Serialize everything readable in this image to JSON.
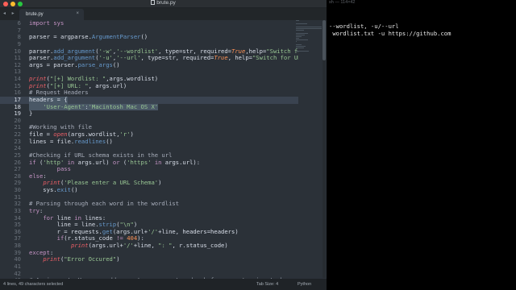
{
  "window": {
    "title": "brute.py"
  },
  "tab": {
    "label": "brute.py",
    "close": "×",
    "nav_arrows": "◂ ▸"
  },
  "colors": {
    "editor_bg": "#2b3138",
    "keyword": "#c594c5",
    "function": "#6699cc",
    "string": "#99c794",
    "comment": "#a7adba",
    "constant": "#f99157",
    "builtin": "#ec5f67"
  },
  "code_lines": [
    {
      "n": "6",
      "segments": [
        [
          "import sys",
          "kw"
        ]
      ]
    },
    {
      "n": "7",
      "segments": [
        [
          "",
          ""
        ]
      ]
    },
    {
      "n": "8",
      "segments": [
        [
          "parser = argparse.",
          ""
        ],
        [
          "ArgumentParser",
          "fn"
        ],
        [
          "()",
          ""
        ]
      ]
    },
    {
      "n": "9",
      "segments": [
        [
          "",
          ""
        ]
      ]
    },
    {
      "n": "10",
      "segments": [
        [
          "parser.",
          ""
        ],
        [
          "add_argument",
          "fn"
        ],
        [
          "(",
          ""
        ],
        [
          "'-w'",
          "st"
        ],
        [
          ",",
          ""
        ],
        [
          "'--wordlist'",
          "st"
        ],
        [
          ", type=str, required=",
          ""
        ],
        [
          "True",
          "ct"
        ],
        [
          ",help=",
          ""
        ],
        [
          "\"Switch for W",
          "st"
        ]
      ]
    },
    {
      "n": "11",
      "segments": [
        [
          "parser.",
          ""
        ],
        [
          "add_argument",
          "fn"
        ],
        [
          "(",
          ""
        ],
        [
          "'-u'",
          "st"
        ],
        [
          ",",
          ""
        ],
        [
          "'--url'",
          "st"
        ],
        [
          ", type=str, required=",
          ""
        ],
        [
          "True",
          "ct"
        ],
        [
          ", help=",
          ""
        ],
        [
          "\"Switch for URL\"",
          "st"
        ],
        [
          ")",
          ""
        ]
      ]
    },
    {
      "n": "12",
      "segments": [
        [
          "args = parser.",
          ""
        ],
        [
          "parse_args",
          "fn"
        ],
        [
          "()",
          ""
        ]
      ]
    },
    {
      "n": "13",
      "segments": [
        [
          "",
          ""
        ]
      ]
    },
    {
      "n": "14",
      "segments": [
        [
          "print",
          "bi"
        ],
        [
          "(",
          ""
        ],
        [
          "\"[+] Wordlist: \"",
          "st"
        ],
        [
          ",args.wordlist)",
          ""
        ]
      ]
    },
    {
      "n": "15",
      "segments": [
        [
          "print",
          "bi"
        ],
        [
          "(",
          ""
        ],
        [
          "\"[+] URL: \"",
          "st"
        ],
        [
          ", args.url)",
          ""
        ]
      ]
    },
    {
      "n": "16",
      "segments": [
        [
          "# Request Headers",
          "cm"
        ]
      ]
    },
    {
      "n": "17",
      "segments": [
        [
          "headers = {",
          ""
        ]
      ],
      "sel": true
    },
    {
      "n": "18",
      "segments": [
        [
          "    ",
          ""
        ],
        [
          "'User-Agent'",
          "st"
        ],
        [
          ":",
          ""
        ],
        [
          "'Macintosh Mac OS X'",
          "st"
        ]
      ],
      "sel": true
    },
    {
      "n": "19",
      "segments": [
        [
          "}",
          ""
        ]
      ],
      "sel": true
    },
    {
      "n": "20",
      "segments": [
        [
          "",
          ""
        ]
      ]
    },
    {
      "n": "21",
      "segments": [
        [
          "#Working with file",
          "cm"
        ]
      ]
    },
    {
      "n": "22",
      "segments": [
        [
          "file = ",
          ""
        ],
        [
          "open",
          "bi"
        ],
        [
          "(args.wordlist,",
          ""
        ],
        [
          "'r'",
          "st"
        ],
        [
          ")",
          ""
        ]
      ]
    },
    {
      "n": "23",
      "segments": [
        [
          "lines = file.",
          ""
        ],
        [
          "readlines",
          "fn"
        ],
        [
          "()",
          ""
        ]
      ]
    },
    {
      "n": "24",
      "segments": [
        [
          "",
          ""
        ]
      ]
    },
    {
      "n": "25",
      "segments": [
        [
          "#Checking if URL schema exists in the url",
          "cm"
        ]
      ]
    },
    {
      "n": "26",
      "segments": [
        [
          "if",
          "kw"
        ],
        [
          " (",
          ""
        ],
        [
          "'http'",
          "st"
        ],
        [
          " ",
          ""
        ],
        [
          "in",
          "kw"
        ],
        [
          " args.url) ",
          ""
        ],
        [
          "or",
          "kw"
        ],
        [
          " (",
          ""
        ],
        [
          "'https'",
          "st"
        ],
        [
          " ",
          ""
        ],
        [
          "in",
          "kw"
        ],
        [
          " args.url):",
          ""
        ]
      ]
    },
    {
      "n": "27",
      "segments": [
        [
          "        ",
          ""
        ],
        [
          "pass",
          "kw"
        ]
      ]
    },
    {
      "n": "28",
      "segments": [
        [
          "else",
          "kw"
        ],
        [
          ":",
          ""
        ]
      ]
    },
    {
      "n": "29",
      "segments": [
        [
          "    ",
          ""
        ],
        [
          "print",
          "bi"
        ],
        [
          "(",
          ""
        ],
        [
          "'Please enter a URL Schema'",
          "st"
        ],
        [
          ")",
          ""
        ]
      ]
    },
    {
      "n": "30",
      "segments": [
        [
          "    sys.",
          ""
        ],
        [
          "exit",
          "fn"
        ],
        [
          "()",
          ""
        ]
      ]
    },
    {
      "n": "31",
      "segments": [
        [
          "",
          ""
        ]
      ]
    },
    {
      "n": "32",
      "segments": [
        [
          "# Parsing through each word in the wordlist",
          "cm"
        ]
      ]
    },
    {
      "n": "33",
      "segments": [
        [
          "try",
          "kw"
        ],
        [
          ":",
          ""
        ]
      ]
    },
    {
      "n": "34",
      "segments": [
        [
          "    ",
          ""
        ],
        [
          "for",
          "kw"
        ],
        [
          " line ",
          ""
        ],
        [
          "in",
          "kw"
        ],
        [
          " lines:",
          ""
        ]
      ]
    },
    {
      "n": "35",
      "segments": [
        [
          "        line = line.",
          ""
        ],
        [
          "strip",
          "fn"
        ],
        [
          "(",
          ""
        ],
        [
          "\"\\n\"",
          "st"
        ],
        [
          ")",
          ""
        ]
      ]
    },
    {
      "n": "36",
      "segments": [
        [
          "        r = requests.",
          ""
        ],
        [
          "get",
          "fn"
        ],
        [
          "(args.url+",
          ""
        ],
        [
          "'/'",
          "st"
        ],
        [
          "+line, headers=headers)",
          ""
        ]
      ]
    },
    {
      "n": "37",
      "segments": [
        [
          "        ",
          ""
        ],
        [
          "if",
          "kw"
        ],
        [
          "(r.status_code ",
          ""
        ],
        [
          "!=",
          "kw"
        ],
        [
          " ",
          ""
        ],
        [
          "404",
          "num"
        ],
        [
          "):",
          ""
        ]
      ]
    },
    {
      "n": "38",
      "segments": [
        [
          "            ",
          ""
        ],
        [
          "print",
          "bi"
        ],
        [
          "(args.url+",
          ""
        ],
        [
          "'/'",
          "st"
        ],
        [
          "+line, ",
          ""
        ],
        [
          "\": \"",
          "st"
        ],
        [
          ", r.status_code)",
          ""
        ]
      ]
    },
    {
      "n": "39",
      "segments": [
        [
          "except",
          "kw"
        ],
        [
          ":",
          ""
        ]
      ]
    },
    {
      "n": "40",
      "segments": [
        [
          "    ",
          ""
        ],
        [
          "print",
          "bi"
        ],
        [
          "(",
          ""
        ],
        [
          "\"Error Occured\"",
          "st"
        ],
        [
          ")",
          ""
        ]
      ]
    },
    {
      "n": "41",
      "segments": [
        [
          "",
          ""
        ]
      ]
    },
    {
      "n": "42",
      "segments": [
        [
          "",
          ""
        ]
      ]
    },
    {
      "n": "43",
      "segments": [
        [
          "# Assignment: You can add an extra argument and ask for an extension to be append",
          "cm"
        ]
      ]
    }
  ],
  "status": {
    "selection": "4 lines, 49 characters selected",
    "tab_size": "Tab Size: 4",
    "syntax": "Python"
  },
  "terminal": {
    "title": "sh — 114×42",
    "lines": [
      "--wordlist, -u/--url",
      " wordlist.txt -u https://github.com"
    ]
  }
}
